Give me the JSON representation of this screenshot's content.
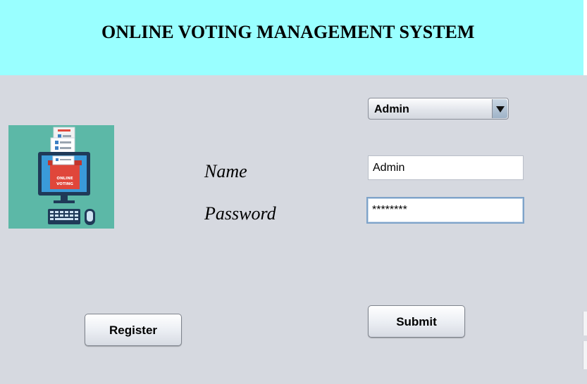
{
  "header": {
    "title": "ONLINE VOTING MANAGEMENT SYSTEM",
    "bg_color": "#99ffff"
  },
  "logo": {
    "label_line1": "ONLINE",
    "label_line2": "VOTING",
    "bg_color": "#5cb8a7",
    "icon": "online-voting-computer-icon"
  },
  "role_select": {
    "value": "Admin",
    "icon": "dropdown-arrow-icon"
  },
  "form": {
    "name_label": "Name",
    "name_value": "Admin",
    "password_label": "Password",
    "password_value": "********"
  },
  "buttons": {
    "register": "Register",
    "submit": "Submit"
  }
}
